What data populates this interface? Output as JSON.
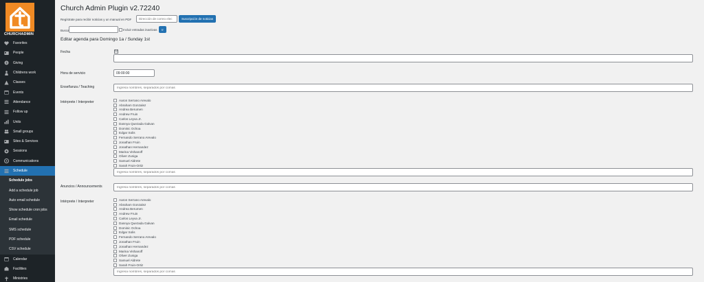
{
  "sidebar": {
    "brand": "CHURCHADMIN",
    "items": [
      {
        "label": "Favorites",
        "icon": "heart-icon"
      },
      {
        "label": "People",
        "icon": "id-card-icon"
      },
      {
        "label": "Giving",
        "icon": "giving-icon"
      },
      {
        "label": "Childrens work",
        "icon": "child-icon"
      },
      {
        "label": "Classes",
        "icon": "classes-icon"
      },
      {
        "label": "Events",
        "icon": "calendar-icon"
      },
      {
        "label": "Attendance",
        "icon": "list-icon"
      },
      {
        "label": "Follow up",
        "icon": "list-icon"
      },
      {
        "label": "Units",
        "icon": "units-icon"
      },
      {
        "label": "Small groups",
        "icon": "groups-icon"
      },
      {
        "label": "Sites & Services",
        "icon": "id-card-icon"
      },
      {
        "label": "Sessions",
        "icon": "sessions-icon"
      },
      {
        "label": "Communications",
        "icon": "communications-icon"
      },
      {
        "label": "Schedule",
        "icon": "list-icon"
      }
    ],
    "submenu": [
      "Schedule jobs",
      "Add a schedule job",
      "Auto email schedule",
      "Show schedule cron jobs",
      "Email schedule",
      "SMS schedule",
      "PDF schedule",
      "CSV schedule"
    ],
    "items_after": [
      {
        "label": "Calendar",
        "icon": "calendar-icon"
      },
      {
        "label": "Facilities",
        "icon": "facilities-icon"
      },
      {
        "label": "Ministries",
        "icon": "ministries-icon"
      }
    ]
  },
  "header": {
    "title": "Church Admin Plugin v2.72240",
    "newsletter_text": "Regístrate para recibir noticias y un manual en PDF",
    "email_placeholder": "Dirección de correo elec",
    "subscribe_label": "Suscripción de noticias",
    "search_label": "Buscar",
    "inactive_label": "Incluir entradas inactivas",
    "go_label": "Ir"
  },
  "form": {
    "heading": "Editar agenda para Domingo 1a / Sunday 1st",
    "fecha_label": "Fecha",
    "hora_label": "Hora de servicio",
    "hora_value": "09:00:00",
    "teaching_label": "Enseñanza / Teaching",
    "names_placeholder": "Ingresa nombres, separados por comas",
    "interpreter_label_1": "Intérprete / Interpreter",
    "announcements_label": "Anuncios / Announcements",
    "interpreter_label_2": "Intérprete / Interpreter",
    "people": [
      "Aaron Serrano Arevalo",
      "Abraham Gonzalez",
      "Andrea Berumen",
      "Andrew Fruin",
      "Carlos Leyva Jr.",
      "Dannya Quezada Galvan",
      "Dominic Ochoa",
      "Edgar Solis",
      "Fernando Serrano Arevalo",
      "Jonathan Fruin",
      "Jonathan Hernandez",
      "Marina Vishanoff",
      "Oliver Zuniga",
      "Samuel Aldrete",
      "Sarah Fruin-Ortiz"
    ]
  },
  "colors": {
    "sidebar_bg": "#1d2327",
    "accent": "#2271b1",
    "logo": "#f08a24"
  }
}
